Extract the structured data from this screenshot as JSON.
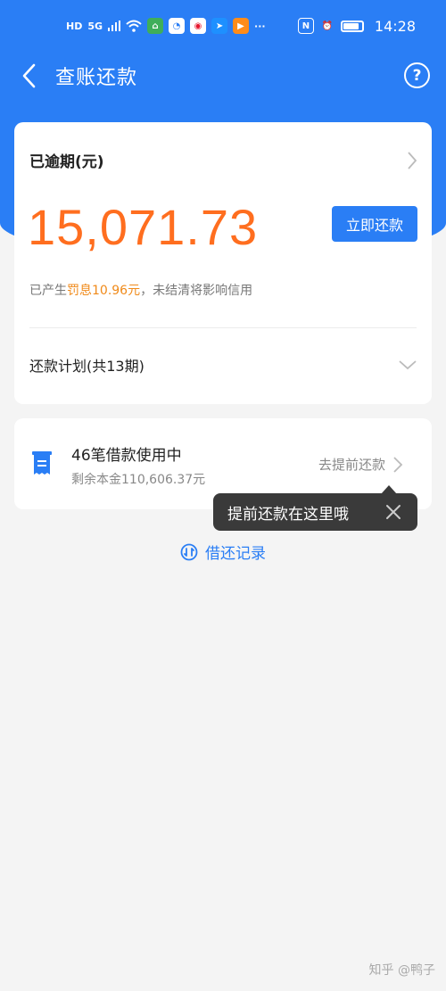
{
  "status_bar": {
    "left_labels": [
      "HD",
      "5G"
    ],
    "time": "14:28"
  },
  "nav": {
    "title": "查账还款",
    "help_label": "?"
  },
  "overdue": {
    "label": "已逾期(元)",
    "amount": "15,071.73",
    "repay_button": "立即还款",
    "note_prefix": "已产生",
    "note_highlight": "罚息10.96元",
    "note_suffix": "，未结清将影响信用",
    "plan_label": "还款计划(共13期)"
  },
  "loans": {
    "title": "46笔借款使用中",
    "remaining": "剩余本金110,606.37元",
    "prepay_link": "去提前还款"
  },
  "tooltip": {
    "text": "提前还款在这里哦"
  },
  "records_link": "借还记录",
  "watermark": "知乎 @鸭子",
  "colors": {
    "brand_blue": "#2a7ef5",
    "amount_orange": "#ff6e1f",
    "highlight_orange": "#f08a1a"
  }
}
